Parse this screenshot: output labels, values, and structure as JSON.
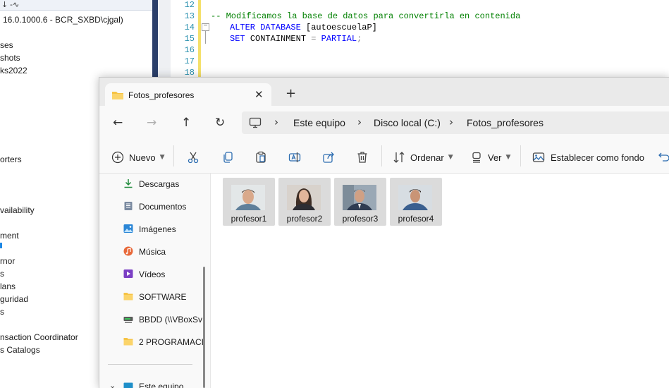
{
  "ssms": {
    "toolbar_icons": [
      "↓",
      "-∿"
    ],
    "server_node": "16.0.1000.6 - BCR_SXBD\\cjgal)",
    "tree": [
      "ses",
      "shots",
      "ks2022",
      "orters",
      "vailability",
      "ment",
      "rnor",
      "s",
      "lans",
      "guridad",
      "s",
      "nsaction Coordinator",
      "s Catalogs"
    ],
    "line_numbers": [
      "12",
      "13",
      "14",
      "15",
      "16",
      "17",
      "18"
    ],
    "code": {
      "comment": "-- Modificamos la base de datos para convertirla en contenida",
      "alter_kw": "ALTER DATABASE",
      "alter_arg": "[autoescuelaP]",
      "set_kw": "SET",
      "set_mid": "CONTAINMENT",
      "set_eq": "=",
      "set_val": "PARTIAL",
      "set_end": ";"
    }
  },
  "window": {
    "tab_title": "Fotos_profesores",
    "tab_close": "✕",
    "new_tab": "+",
    "nav": {
      "back": "←",
      "forward": "→",
      "up": "↑",
      "refresh": "↻"
    },
    "breadcrumb": [
      "Este equipo",
      "Disco local (C:)",
      "Fotos_profesores"
    ],
    "breadcrumb_sep": "›",
    "commands": {
      "new_label": "Nuevo",
      "sort_label": "Ordenar",
      "view_label": "Ver",
      "wallpaper_label": "Establecer como fondo"
    },
    "nav_pane": [
      {
        "label": "Descargas",
        "icon": "download-icon",
        "pinned": true
      },
      {
        "label": "Documentos",
        "icon": "documents-icon",
        "pinned": true
      },
      {
        "label": "Imágenes",
        "icon": "pictures-icon",
        "pinned": true
      },
      {
        "label": "Música",
        "icon": "music-icon",
        "pinned": true
      },
      {
        "label": "Vídeos",
        "icon": "videos-icon",
        "pinned": true
      },
      {
        "label": "SOFTWARE",
        "icon": "folder-icon",
        "pinned": true
      },
      {
        "label": "BBDD (\\\\VBoxSv",
        "icon": "network-drive-icon",
        "pinned": false
      },
      {
        "label": "2 PROGRAMACI",
        "icon": "folder-icon",
        "pinned": false
      },
      {
        "label": "Este equipo",
        "icon": "this-pc-icon",
        "pinned": false
      }
    ],
    "pin_glyph": "📌",
    "files": [
      {
        "name": "profesor1"
      },
      {
        "name": "profesor2"
      },
      {
        "name": "profesor3"
      },
      {
        "name": "profesor4"
      }
    ]
  },
  "colors": {
    "ssms_splitter": "#2b3f6a",
    "code_comment": "#008000",
    "code_keyword": "#0000ff",
    "line_number": "#2b91af",
    "selected_tile": "#dbdbdb",
    "folder": "#f6c344"
  }
}
